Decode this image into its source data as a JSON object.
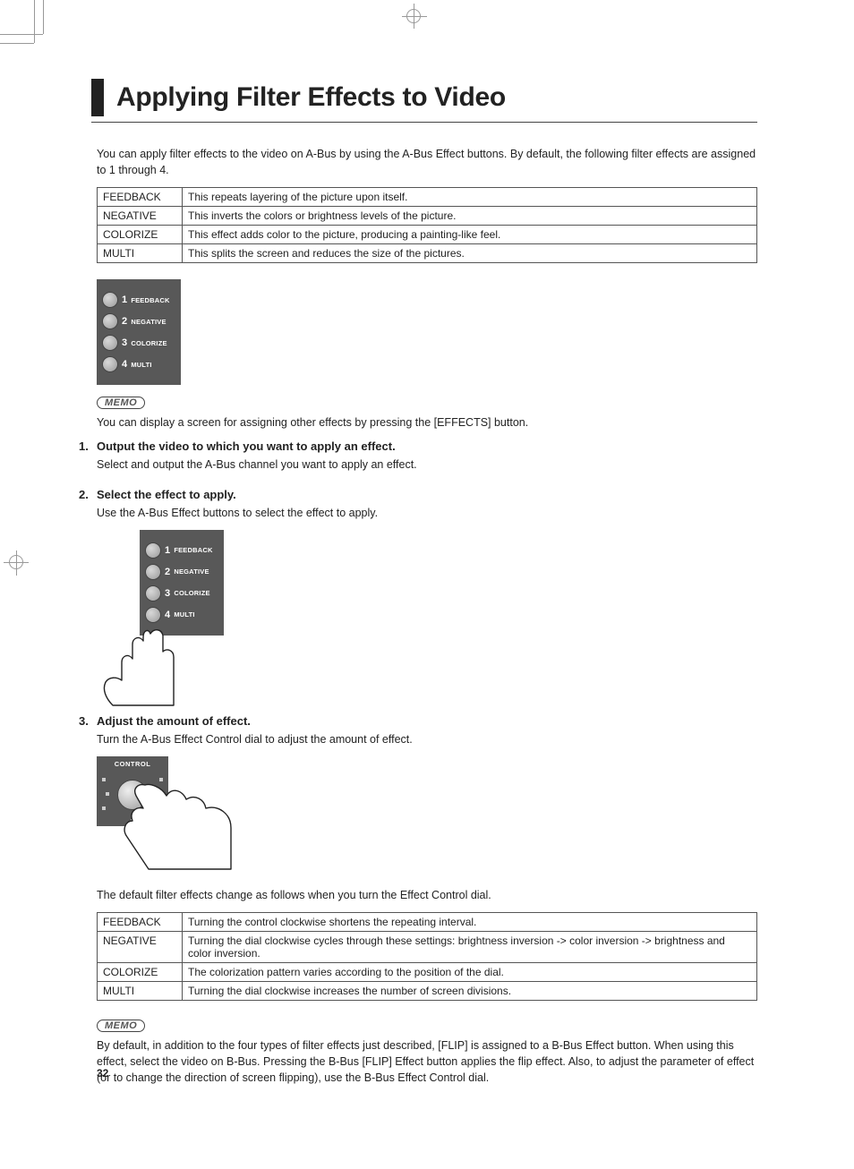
{
  "page_number": "32",
  "title": "Applying Filter Effects to Video",
  "intro": "You can apply filter effects to the video on A-Bus by using the A-Bus Effect buttons. By default, the following filter effects are assigned to 1 through 4.",
  "table1": {
    "rows": [
      {
        "name": "FEEDBACK",
        "desc": "This repeats layering of the picture upon itself."
      },
      {
        "name": "NEGATIVE",
        "desc": "This inverts the colors or brightness levels of the picture."
      },
      {
        "name": "COLORIZE",
        "desc": "This effect adds color to the picture, producing a painting-like feel."
      },
      {
        "name": "MULTI",
        "desc": "This splits the screen and reduces the size of the pictures."
      }
    ]
  },
  "panel_buttons": [
    {
      "num": "1",
      "label": "FEEDBACK"
    },
    {
      "num": "2",
      "label": "NEGATIVE"
    },
    {
      "num": "3",
      "label": "COLORIZE"
    },
    {
      "num": "4",
      "label": "MULTI"
    }
  ],
  "memo_label": "MEMO",
  "memo1": "You can display a screen for assigning other effects by pressing the [EFFECTS] button.",
  "steps": [
    {
      "num": "1.",
      "title": "Output the video to which you want to apply an effect.",
      "body": "Select and output the A-Bus channel you want to apply an effect."
    },
    {
      "num": "2.",
      "title": "Select the effect to apply.",
      "body": "Use the A-Bus Effect buttons to select the effect to apply."
    },
    {
      "num": "3.",
      "title": "Adjust the amount of effect.",
      "body": "Turn the A-Bus Effect Control dial to adjust the amount of effect."
    }
  ],
  "control_label": "CONTROL",
  "table2_intro": "The default filter effects change as follows when you turn the Effect Control dial.",
  "table2": {
    "rows": [
      {
        "name": "FEEDBACK",
        "desc": "Turning the control clockwise shortens the repeating interval."
      },
      {
        "name": "NEGATIVE",
        "desc": "Turning the dial clockwise cycles through these settings: brightness inversion -> color inversion -> brightness and color inversion."
      },
      {
        "name": "COLORIZE",
        "desc": "The colorization pattern varies according to the position of the dial."
      },
      {
        "name": "MULTI",
        "desc": "Turning the dial clockwise increases the number of screen divisions."
      }
    ]
  },
  "memo2": "By default, in addition to the four types of filter effects just described, [FLIP] is assigned to a B-Bus Effect button. When using this effect, select the video on B-Bus. Pressing the B-Bus [FLIP] Effect button applies the flip effect. Also, to adjust the parameter of effect (or to change the direction of screen flipping), use the B-Bus Effect Control dial."
}
